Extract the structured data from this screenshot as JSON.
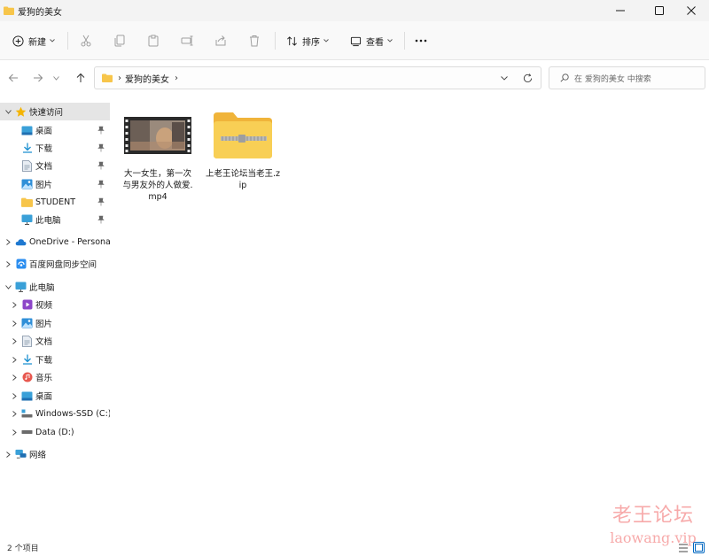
{
  "window": {
    "title": "爱狗的美女",
    "controls": {
      "minimize": "minimize-icon",
      "maximize": "maximize-icon",
      "close": "close-icon"
    }
  },
  "toolbar": {
    "new_label": "新建",
    "sort_label": "排序",
    "view_label": "查看",
    "icons": [
      "cut-icon",
      "copy-icon",
      "paste-icon",
      "rename-icon",
      "share-icon",
      "delete-icon",
      "more-icon"
    ]
  },
  "address": {
    "crumbs": [
      "爱狗的美女"
    ],
    "search_placeholder": "在 爱狗的美女 中搜索"
  },
  "sidebar": {
    "quick_access": {
      "label": "快速访问",
      "items": [
        {
          "label": "桌面",
          "icon": "desktop-icon"
        },
        {
          "label": "下载",
          "icon": "download-icon"
        },
        {
          "label": "文档",
          "icon": "document-icon"
        },
        {
          "label": "图片",
          "icon": "pictures-icon"
        },
        {
          "label": "STUDENT",
          "icon": "folder-icon"
        },
        {
          "label": "此电脑",
          "icon": "computer-icon"
        }
      ]
    },
    "onedrive": "OneDrive - Persona",
    "baidu": "百度网盘同步空间",
    "this_pc": {
      "label": "此电脑",
      "items": [
        {
          "label": "视频",
          "icon": "videos-icon"
        },
        {
          "label": "图片",
          "icon": "pictures-icon"
        },
        {
          "label": "文档",
          "icon": "document-icon"
        },
        {
          "label": "下载",
          "icon": "download-icon"
        },
        {
          "label": "音乐",
          "icon": "music-icon"
        },
        {
          "label": "桌面",
          "icon": "desktop-icon"
        },
        {
          "label": "Windows-SSD (C:)",
          "icon": "drive-c-icon"
        },
        {
          "label": "Data (D:)",
          "icon": "drive-d-icon"
        }
      ]
    },
    "network": "网络"
  },
  "files": [
    {
      "name": "大一女生，第一次与男友外的人做爱.mp4",
      "type": "video-thumbnail-icon"
    },
    {
      "name": "上老王论坛当老王.zip",
      "type": "zip-folder-icon"
    }
  ],
  "status": {
    "count": "2 个项目"
  },
  "watermark": {
    "line1": "老王论坛",
    "line2": "laowang.vip"
  },
  "colors": {
    "accent": "#0067c0",
    "folder": "#f7c54a",
    "selected_bg": "#e5e5e5",
    "watermark": "#f06464"
  }
}
